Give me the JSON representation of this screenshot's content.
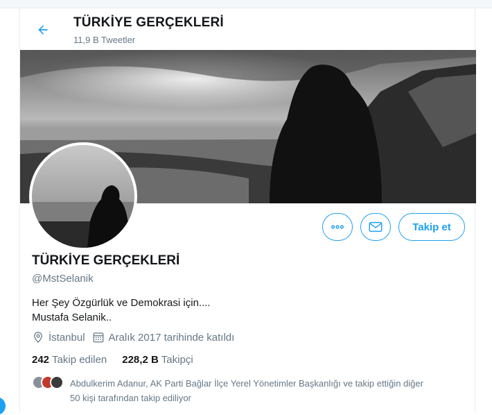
{
  "header": {
    "title": "TÜRKİYE GERÇEKLERİ",
    "subtitle": "11,9 B Tweetler"
  },
  "profile": {
    "name": "TÜRKİYE GERÇEKLERİ",
    "handle": "@MstSelanik",
    "bio_line1": "Her Şey Özgürlük ve Demokrasi için....",
    "bio_line2": "Mustafa Selanik..",
    "location": "İstanbul",
    "joined": "Aralık 2017 tarihinde katıldı"
  },
  "actions": {
    "follow_label": "Takip et",
    "more_icon": "more-icon",
    "message_icon": "envelope-icon"
  },
  "stats": {
    "following_count": "242",
    "following_label": "Takip edilen",
    "followers_count": "228,2 B",
    "followers_label": "Takipçi"
  },
  "followers_you_know": {
    "line1": "Abdulkerim Adanur, AK Parti Bağlar İlçe Yerel Yönetimler Başkanlığı ve takip ettiğin diğer",
    "line2": "50 kişi tarafından takip ediliyor"
  },
  "colors": {
    "accent": "#1da1f2",
    "text_primary": "#14171a",
    "text_secondary": "#657786"
  }
}
